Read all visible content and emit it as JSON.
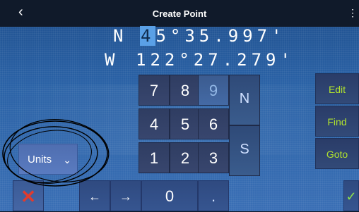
{
  "titlebar": {
    "back_icon": "‹",
    "title": "Create Point",
    "more_icon": "⋮"
  },
  "coordinates": {
    "latitude": {
      "hemisphere": "N",
      "cursor_digit": "4",
      "value_rest": "5°35.997'"
    },
    "longitude": {
      "hemisphere": "W",
      "value": "122°27.279'"
    }
  },
  "keypad": {
    "digits": [
      "7",
      "8",
      "9",
      "4",
      "5",
      "6",
      "1",
      "2",
      "3"
    ],
    "hemisphere_keys": [
      "N",
      "S"
    ],
    "zero": "0",
    "decimal": "."
  },
  "side_buttons": {
    "edit": "Edit",
    "find": "Find",
    "goto": "Goto"
  },
  "units": {
    "label": "Units",
    "chevron": "⌄"
  },
  "bottom_bar": {
    "cancel": "✕",
    "left_arrow": "←",
    "right_arrow": "→",
    "confirm": "✓"
  },
  "colors": {
    "accent": "#b2e42d",
    "cancel": "#e23b2d",
    "cursor": "#5aa0e6"
  }
}
